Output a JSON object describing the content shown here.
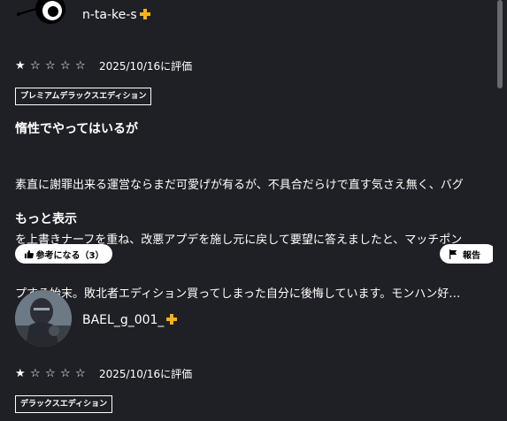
{
  "reviews": [
    {
      "username": "n-ta-ke-s",
      "stars": [
        "★",
        "☆",
        "☆",
        "☆",
        "☆"
      ],
      "rating": 1,
      "date": "2025/10/16に評価",
      "edition": "プレミアムデラックスエディション",
      "title": "惰性でやってはいるが",
      "body_lines": [
        "素直に謝罪出来る運営ならまだ可愛げが有るが、不具合だらけで直す気さえ無く、バグ",
        "を上書きナーフを重ね、改悪アプデを施し元に戻して要望に答えましたと、マッチポン",
        "プする始末。敗北者エディション買ってしまった自分に後悔しています。モンハン好…"
      ],
      "more": "もっと表示",
      "helpful": "参考になる（3）",
      "report": "報告"
    },
    {
      "username": "BAEL_g_001_",
      "stars": [
        "★",
        "☆",
        "☆",
        "☆",
        "☆"
      ],
      "rating": 1,
      "date": "2025/10/16に評価",
      "edition": "デラックスエディション"
    }
  ],
  "colors": {
    "background": "#1f2025",
    "plus_badge": "#f5b21b"
  }
}
